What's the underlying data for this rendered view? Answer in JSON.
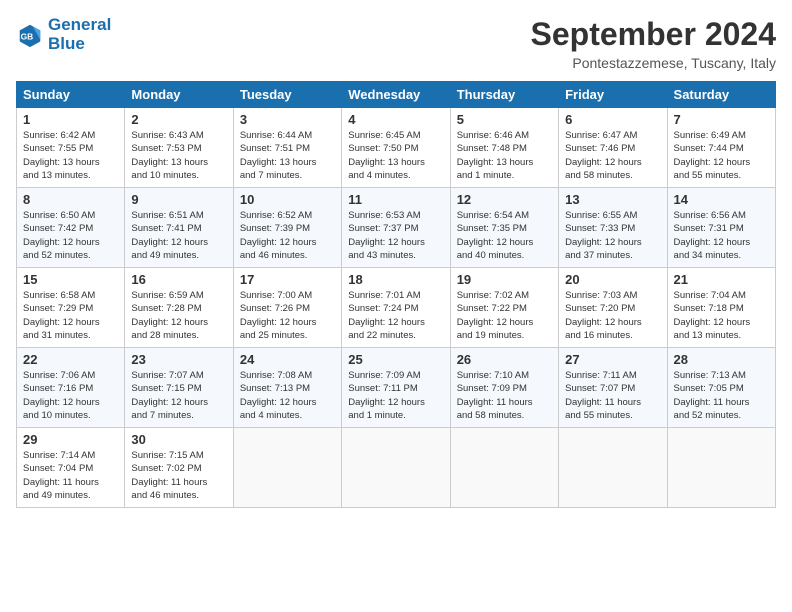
{
  "logo": {
    "line1": "General",
    "line2": "Blue"
  },
  "title": "September 2024",
  "subtitle": "Pontestazzemese, Tuscany, Italy",
  "weekdays": [
    "Sunday",
    "Monday",
    "Tuesday",
    "Wednesday",
    "Thursday",
    "Friday",
    "Saturday"
  ],
  "weeks": [
    [
      {
        "day": "1",
        "info": "Sunrise: 6:42 AM\nSunset: 7:55 PM\nDaylight: 13 hours\nand 13 minutes."
      },
      {
        "day": "2",
        "info": "Sunrise: 6:43 AM\nSunset: 7:53 PM\nDaylight: 13 hours\nand 10 minutes."
      },
      {
        "day": "3",
        "info": "Sunrise: 6:44 AM\nSunset: 7:51 PM\nDaylight: 13 hours\nand 7 minutes."
      },
      {
        "day": "4",
        "info": "Sunrise: 6:45 AM\nSunset: 7:50 PM\nDaylight: 13 hours\nand 4 minutes."
      },
      {
        "day": "5",
        "info": "Sunrise: 6:46 AM\nSunset: 7:48 PM\nDaylight: 13 hours\nand 1 minute."
      },
      {
        "day": "6",
        "info": "Sunrise: 6:47 AM\nSunset: 7:46 PM\nDaylight: 12 hours\nand 58 minutes."
      },
      {
        "day": "7",
        "info": "Sunrise: 6:49 AM\nSunset: 7:44 PM\nDaylight: 12 hours\nand 55 minutes."
      }
    ],
    [
      {
        "day": "8",
        "info": "Sunrise: 6:50 AM\nSunset: 7:42 PM\nDaylight: 12 hours\nand 52 minutes."
      },
      {
        "day": "9",
        "info": "Sunrise: 6:51 AM\nSunset: 7:41 PM\nDaylight: 12 hours\nand 49 minutes."
      },
      {
        "day": "10",
        "info": "Sunrise: 6:52 AM\nSunset: 7:39 PM\nDaylight: 12 hours\nand 46 minutes."
      },
      {
        "day": "11",
        "info": "Sunrise: 6:53 AM\nSunset: 7:37 PM\nDaylight: 12 hours\nand 43 minutes."
      },
      {
        "day": "12",
        "info": "Sunrise: 6:54 AM\nSunset: 7:35 PM\nDaylight: 12 hours\nand 40 minutes."
      },
      {
        "day": "13",
        "info": "Sunrise: 6:55 AM\nSunset: 7:33 PM\nDaylight: 12 hours\nand 37 minutes."
      },
      {
        "day": "14",
        "info": "Sunrise: 6:56 AM\nSunset: 7:31 PM\nDaylight: 12 hours\nand 34 minutes."
      }
    ],
    [
      {
        "day": "15",
        "info": "Sunrise: 6:58 AM\nSunset: 7:29 PM\nDaylight: 12 hours\nand 31 minutes."
      },
      {
        "day": "16",
        "info": "Sunrise: 6:59 AM\nSunset: 7:28 PM\nDaylight: 12 hours\nand 28 minutes."
      },
      {
        "day": "17",
        "info": "Sunrise: 7:00 AM\nSunset: 7:26 PM\nDaylight: 12 hours\nand 25 minutes."
      },
      {
        "day": "18",
        "info": "Sunrise: 7:01 AM\nSunset: 7:24 PM\nDaylight: 12 hours\nand 22 minutes."
      },
      {
        "day": "19",
        "info": "Sunrise: 7:02 AM\nSunset: 7:22 PM\nDaylight: 12 hours\nand 19 minutes."
      },
      {
        "day": "20",
        "info": "Sunrise: 7:03 AM\nSunset: 7:20 PM\nDaylight: 12 hours\nand 16 minutes."
      },
      {
        "day": "21",
        "info": "Sunrise: 7:04 AM\nSunset: 7:18 PM\nDaylight: 12 hours\nand 13 minutes."
      }
    ],
    [
      {
        "day": "22",
        "info": "Sunrise: 7:06 AM\nSunset: 7:16 PM\nDaylight: 12 hours\nand 10 minutes."
      },
      {
        "day": "23",
        "info": "Sunrise: 7:07 AM\nSunset: 7:15 PM\nDaylight: 12 hours\nand 7 minutes."
      },
      {
        "day": "24",
        "info": "Sunrise: 7:08 AM\nSunset: 7:13 PM\nDaylight: 12 hours\nand 4 minutes."
      },
      {
        "day": "25",
        "info": "Sunrise: 7:09 AM\nSunset: 7:11 PM\nDaylight: 12 hours\nand 1 minute."
      },
      {
        "day": "26",
        "info": "Sunrise: 7:10 AM\nSunset: 7:09 PM\nDaylight: 11 hours\nand 58 minutes."
      },
      {
        "day": "27",
        "info": "Sunrise: 7:11 AM\nSunset: 7:07 PM\nDaylight: 11 hours\nand 55 minutes."
      },
      {
        "day": "28",
        "info": "Sunrise: 7:13 AM\nSunset: 7:05 PM\nDaylight: 11 hours\nand 52 minutes."
      }
    ],
    [
      {
        "day": "29",
        "info": "Sunrise: 7:14 AM\nSunset: 7:04 PM\nDaylight: 11 hours\nand 49 minutes."
      },
      {
        "day": "30",
        "info": "Sunrise: 7:15 AM\nSunset: 7:02 PM\nDaylight: 11 hours\nand 46 minutes."
      },
      {
        "day": "",
        "info": ""
      },
      {
        "day": "",
        "info": ""
      },
      {
        "day": "",
        "info": ""
      },
      {
        "day": "",
        "info": ""
      },
      {
        "day": "",
        "info": ""
      }
    ]
  ]
}
